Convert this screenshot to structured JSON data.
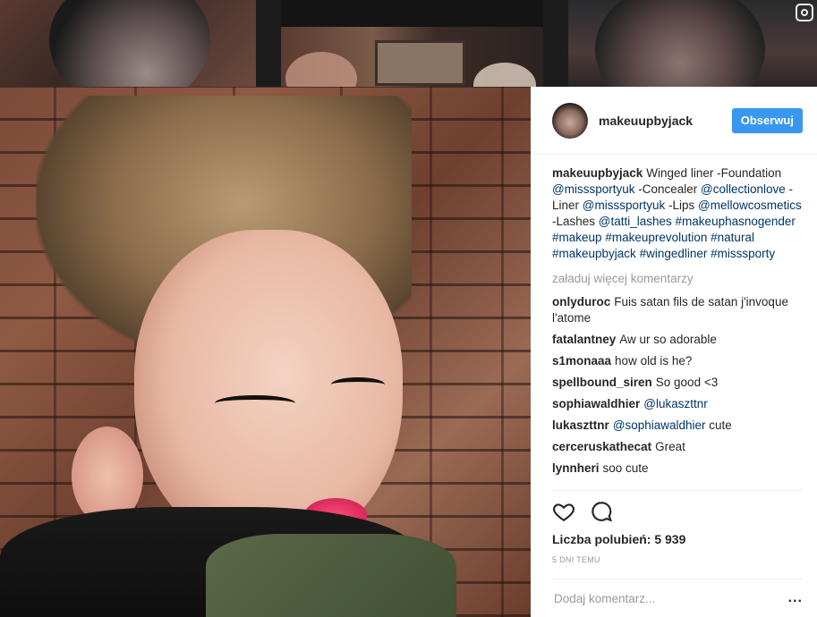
{
  "header": {
    "username": "makeuupbyjack",
    "follow_label": "Obserwuj"
  },
  "caption": {
    "username": "makeuupbyjack",
    "parts": [
      {
        "t": "Winged liner -Foundation ",
        "link": false
      },
      {
        "t": "@misssportyuk",
        "link": true
      },
      {
        "t": " -Concealer ",
        "link": false
      },
      {
        "t": "@collectionlove",
        "link": true
      },
      {
        "t": " -Liner ",
        "link": false
      },
      {
        "t": "@misssportyuk",
        "link": true
      },
      {
        "t": " -Lips ",
        "link": false
      },
      {
        "t": "@mellowcosmetics",
        "link": true
      },
      {
        "t": " -Lashes ",
        "link": false
      },
      {
        "t": "@tatti_lashes",
        "link": true
      },
      {
        "t": " ",
        "link": false
      },
      {
        "t": "#makeuphasnogender",
        "link": true
      },
      {
        "t": " ",
        "link": false
      },
      {
        "t": "#makeup",
        "link": true
      },
      {
        "t": " ",
        "link": false
      },
      {
        "t": "#makeuprevolution",
        "link": true
      },
      {
        "t": " ",
        "link": false
      },
      {
        "t": "#natural",
        "link": true
      },
      {
        "t": " ",
        "link": false
      },
      {
        "t": "#makeupbyjack",
        "link": true
      },
      {
        "t": " ",
        "link": false
      },
      {
        "t": "#wingedliner",
        "link": true
      },
      {
        "t": " ",
        "link": false
      },
      {
        "t": "#misssporty",
        "link": true
      }
    ]
  },
  "load_more": "załaduj więcej komentarzy",
  "comments": [
    {
      "user": "onlyduroc",
      "parts": [
        {
          "t": "Fuis satan fils de satan j'invoque l'atome",
          "link": false
        }
      ]
    },
    {
      "user": "fatalantney",
      "parts": [
        {
          "t": "Aw ur so adorable",
          "link": false
        }
      ]
    },
    {
      "user": "s1monaaa",
      "parts": [
        {
          "t": "how old is he?",
          "link": false
        }
      ]
    },
    {
      "user": "spellbound_siren",
      "parts": [
        {
          "t": "So good <3",
          "link": false
        }
      ]
    },
    {
      "user": "sophiawaldhier",
      "parts": [
        {
          "t": "@lukaszttnr",
          "link": true
        }
      ]
    },
    {
      "user": "lukaszttnr",
      "parts": [
        {
          "t": "@sophiawaldhier",
          "link": true
        },
        {
          "t": " cute",
          "link": false
        }
      ]
    },
    {
      "user": "cerceruskathecat",
      "parts": [
        {
          "t": "Great",
          "link": false
        }
      ]
    },
    {
      "user": "lynnheri",
      "parts": [
        {
          "t": "soo cute",
          "link": false
        }
      ]
    }
  ],
  "actions": {
    "like_icon": "heart-icon",
    "comment_icon": "speech-bubble-icon"
  },
  "likes": "Liczba polubień: 5 939",
  "timestamp": "5 dni temu",
  "add_comment": {
    "placeholder": "Dodaj komentarz...",
    "more_label": "..."
  }
}
